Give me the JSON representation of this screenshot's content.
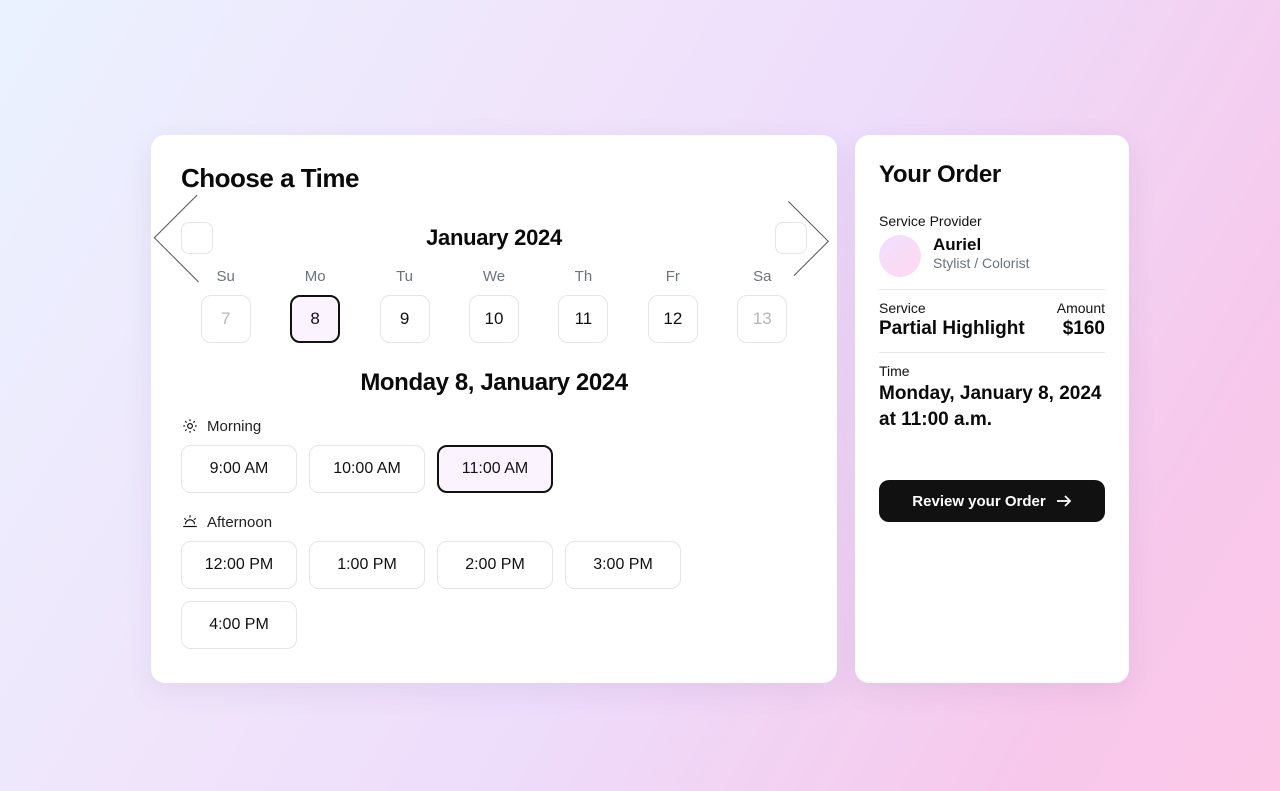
{
  "left": {
    "title": "Choose a Time",
    "month_label": "January 2024",
    "dow": [
      "Su",
      "Mo",
      "Tu",
      "We",
      "Th",
      "Fr",
      "Sa"
    ],
    "days": [
      {
        "n": "7",
        "disabled": true,
        "selected": false
      },
      {
        "n": "8",
        "disabled": false,
        "selected": true
      },
      {
        "n": "9",
        "disabled": false,
        "selected": false
      },
      {
        "n": "10",
        "disabled": false,
        "selected": false
      },
      {
        "n": "11",
        "disabled": false,
        "selected": false
      },
      {
        "n": "12",
        "disabled": false,
        "selected": false
      },
      {
        "n": "13",
        "disabled": true,
        "selected": false
      }
    ],
    "date_heading": "Monday 8, January 2024",
    "morning_label": "Morning",
    "afternoon_label": "Afternoon",
    "morning_slots": [
      {
        "t": "9:00 AM",
        "selected": false
      },
      {
        "t": "10:00 AM",
        "selected": false
      },
      {
        "t": "11:00 AM",
        "selected": true
      }
    ],
    "afternoon_slots": [
      {
        "t": "12:00 PM",
        "selected": false
      },
      {
        "t": "1:00 PM",
        "selected": false
      },
      {
        "t": "2:00 PM",
        "selected": false
      },
      {
        "t": "3:00 PM",
        "selected": false
      },
      {
        "t": "4:00 PM",
        "selected": false
      }
    ]
  },
  "right": {
    "title": "Your Order",
    "provider_label": "Service Provider",
    "provider_name": "Auriel",
    "provider_role": "Stylist / Colorist",
    "service_label": "Service",
    "service_value": "Partial Highlight",
    "amount_label": "Amount",
    "amount_value": "$160",
    "time_label": "Time",
    "time_value": "Monday, January 8, 2024 at 11:00 a.m.",
    "review_label": "Review your Order"
  }
}
